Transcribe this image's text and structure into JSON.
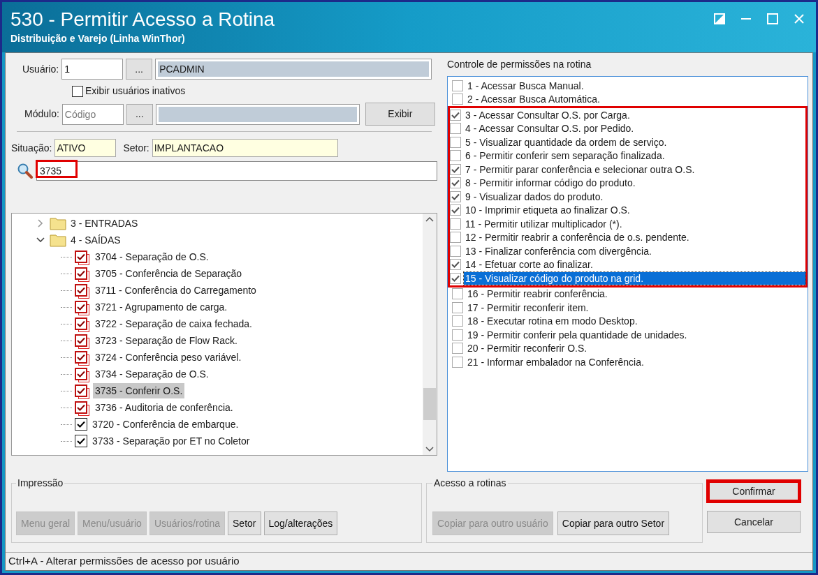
{
  "window": {
    "title": "530 - Permitir Acesso a Rotina",
    "subtitle": "Distribuição e Varejo (Linha WinThor)"
  },
  "user": {
    "label": "Usuário:",
    "code": "1",
    "lookup": "...",
    "name": "PCADMIN"
  },
  "show_inactive": {
    "label": "Exibir usuários inativos",
    "checked": false
  },
  "module": {
    "label": "Módulo:",
    "placeholder": "Código",
    "lookup": "...",
    "button": "Exibir"
  },
  "situation": {
    "label": "Situação:",
    "value": "ATIVO"
  },
  "sector": {
    "label": "Setor:",
    "value": "IMPLANTACAO"
  },
  "search": {
    "value": "3735",
    "highlighted": true
  },
  "tree": [
    {
      "label": "3 - ENTRADAS",
      "expanded": false
    },
    {
      "label": "4 - SAÍDAS",
      "expanded": true,
      "children": [
        {
          "label": "3704 - Separação de O.S.",
          "checked": true,
          "kind": "stacked",
          "selected": false
        },
        {
          "label": "3705 - Conferência de Separação",
          "checked": true,
          "kind": "stacked",
          "selected": false
        },
        {
          "label": "3711 - Conferência do Carregamento",
          "checked": true,
          "kind": "stacked",
          "selected": false
        },
        {
          "label": "3721 - Agrupamento de carga.",
          "checked": true,
          "kind": "stacked",
          "selected": false
        },
        {
          "label": "3722 - Separação de caixa fechada.",
          "checked": true,
          "kind": "stacked",
          "selected": false
        },
        {
          "label": "3723 - Separação de Flow Rack.",
          "checked": true,
          "kind": "stacked",
          "selected": false
        },
        {
          "label": "3724 - Conferência peso variável.",
          "checked": true,
          "kind": "stacked",
          "selected": false
        },
        {
          "label": "3734 - Separação de O.S.",
          "checked": true,
          "kind": "stacked",
          "selected": false
        },
        {
          "label": "3735 - Conferir O.S.",
          "checked": true,
          "kind": "stacked",
          "selected": true
        },
        {
          "label": "3736 - Auditoria de conferência.",
          "checked": true,
          "kind": "stacked",
          "selected": false
        },
        {
          "label": "3720 - Conferência de embarque.",
          "checked": true,
          "kind": "single",
          "selected": false
        },
        {
          "label": "3733 - Separação por ET no Coletor",
          "checked": true,
          "kind": "single",
          "selected": false
        }
      ]
    }
  ],
  "permissions": {
    "title": "Controle de permissões na rotina",
    "items": [
      {
        "label": "1 - Acessar Busca Manual.",
        "checked": false,
        "selected": false,
        "highlighted": false
      },
      {
        "label": "2 - Acessar Busca Automática.",
        "checked": false,
        "selected": false,
        "highlighted": false
      },
      {
        "label": "3 - Acessar Consultar O.S. por Carga.",
        "checked": true,
        "selected": false,
        "highlighted": true
      },
      {
        "label": "4 - Acessar Consultar O.S. por Pedido.",
        "checked": false,
        "selected": false,
        "highlighted": true
      },
      {
        "label": "5 - Visualizar quantidade da ordem de serviço.",
        "checked": false,
        "selected": false,
        "highlighted": true
      },
      {
        "label": "6 - Permitir conferir sem separação finalizada.",
        "checked": false,
        "selected": false,
        "highlighted": true
      },
      {
        "label": "7 - Permitir parar conferência e selecionar outra O.S.",
        "checked": true,
        "selected": false,
        "highlighted": true
      },
      {
        "label": "8 - Permitir informar código do produto.",
        "checked": true,
        "selected": false,
        "highlighted": true
      },
      {
        "label": "9 - Visualizar dados do produto.",
        "checked": true,
        "selected": false,
        "highlighted": true
      },
      {
        "label": "10 - Imprimir etiqueta ao finalizar O.S.",
        "checked": true,
        "selected": false,
        "highlighted": true
      },
      {
        "label": "11 - Permitir utilizar multiplicador (*).",
        "checked": false,
        "selected": false,
        "highlighted": true
      },
      {
        "label": "12 - Permitir reabrir a conferência de o.s. pendente.",
        "checked": false,
        "selected": false,
        "highlighted": true
      },
      {
        "label": "13 - Finalizar conferência com divergência.",
        "checked": false,
        "selected": false,
        "highlighted": true
      },
      {
        "label": "14 - Efetuar corte ao finalizar.",
        "checked": true,
        "selected": false,
        "highlighted": true
      },
      {
        "label": "15 - Visualizar código do produto na grid.",
        "checked": true,
        "selected": true,
        "highlighted": true
      },
      {
        "label": "16 - Permitir reabrir conferência.",
        "checked": false,
        "selected": false,
        "highlighted": false
      },
      {
        "label": "17 - Permitir reconferir item.",
        "checked": false,
        "selected": false,
        "highlighted": false
      },
      {
        "label": "18 - Executar rotina em modo Desktop.",
        "checked": false,
        "selected": false,
        "highlighted": false
      },
      {
        "label": "19 - Permitir conferir pela quantidade de unidades.",
        "checked": false,
        "selected": false,
        "highlighted": false
      },
      {
        "label": "20 - Permitir reconferir O.S.",
        "checked": false,
        "selected": false,
        "highlighted": false
      },
      {
        "label": "21 - Informar embalador na Conferência.",
        "checked": false,
        "selected": false,
        "highlighted": false
      }
    ]
  },
  "print_group": {
    "title": "Impressão",
    "buttons": [
      {
        "label": "Menu geral",
        "disabled": true
      },
      {
        "label": "Menu/usuário",
        "disabled": true
      },
      {
        "label": "Usuários/rotina",
        "disabled": true
      },
      {
        "label": "Setor",
        "disabled": false
      },
      {
        "label": "Log/alterações",
        "disabled": false
      }
    ]
  },
  "access_group": {
    "title": "Acesso a rotinas",
    "buttons": [
      {
        "label": "Copiar para outro usuário",
        "disabled": true
      },
      {
        "label": "Copiar para outro Setor",
        "disabled": false
      }
    ]
  },
  "actions": [
    {
      "label": "Confirmar",
      "highlighted": true
    },
    {
      "label": "Cancelar",
      "highlighted": false
    }
  ],
  "status_bar": "Ctrl+A - Alterar permissões de acesso por usuário"
}
